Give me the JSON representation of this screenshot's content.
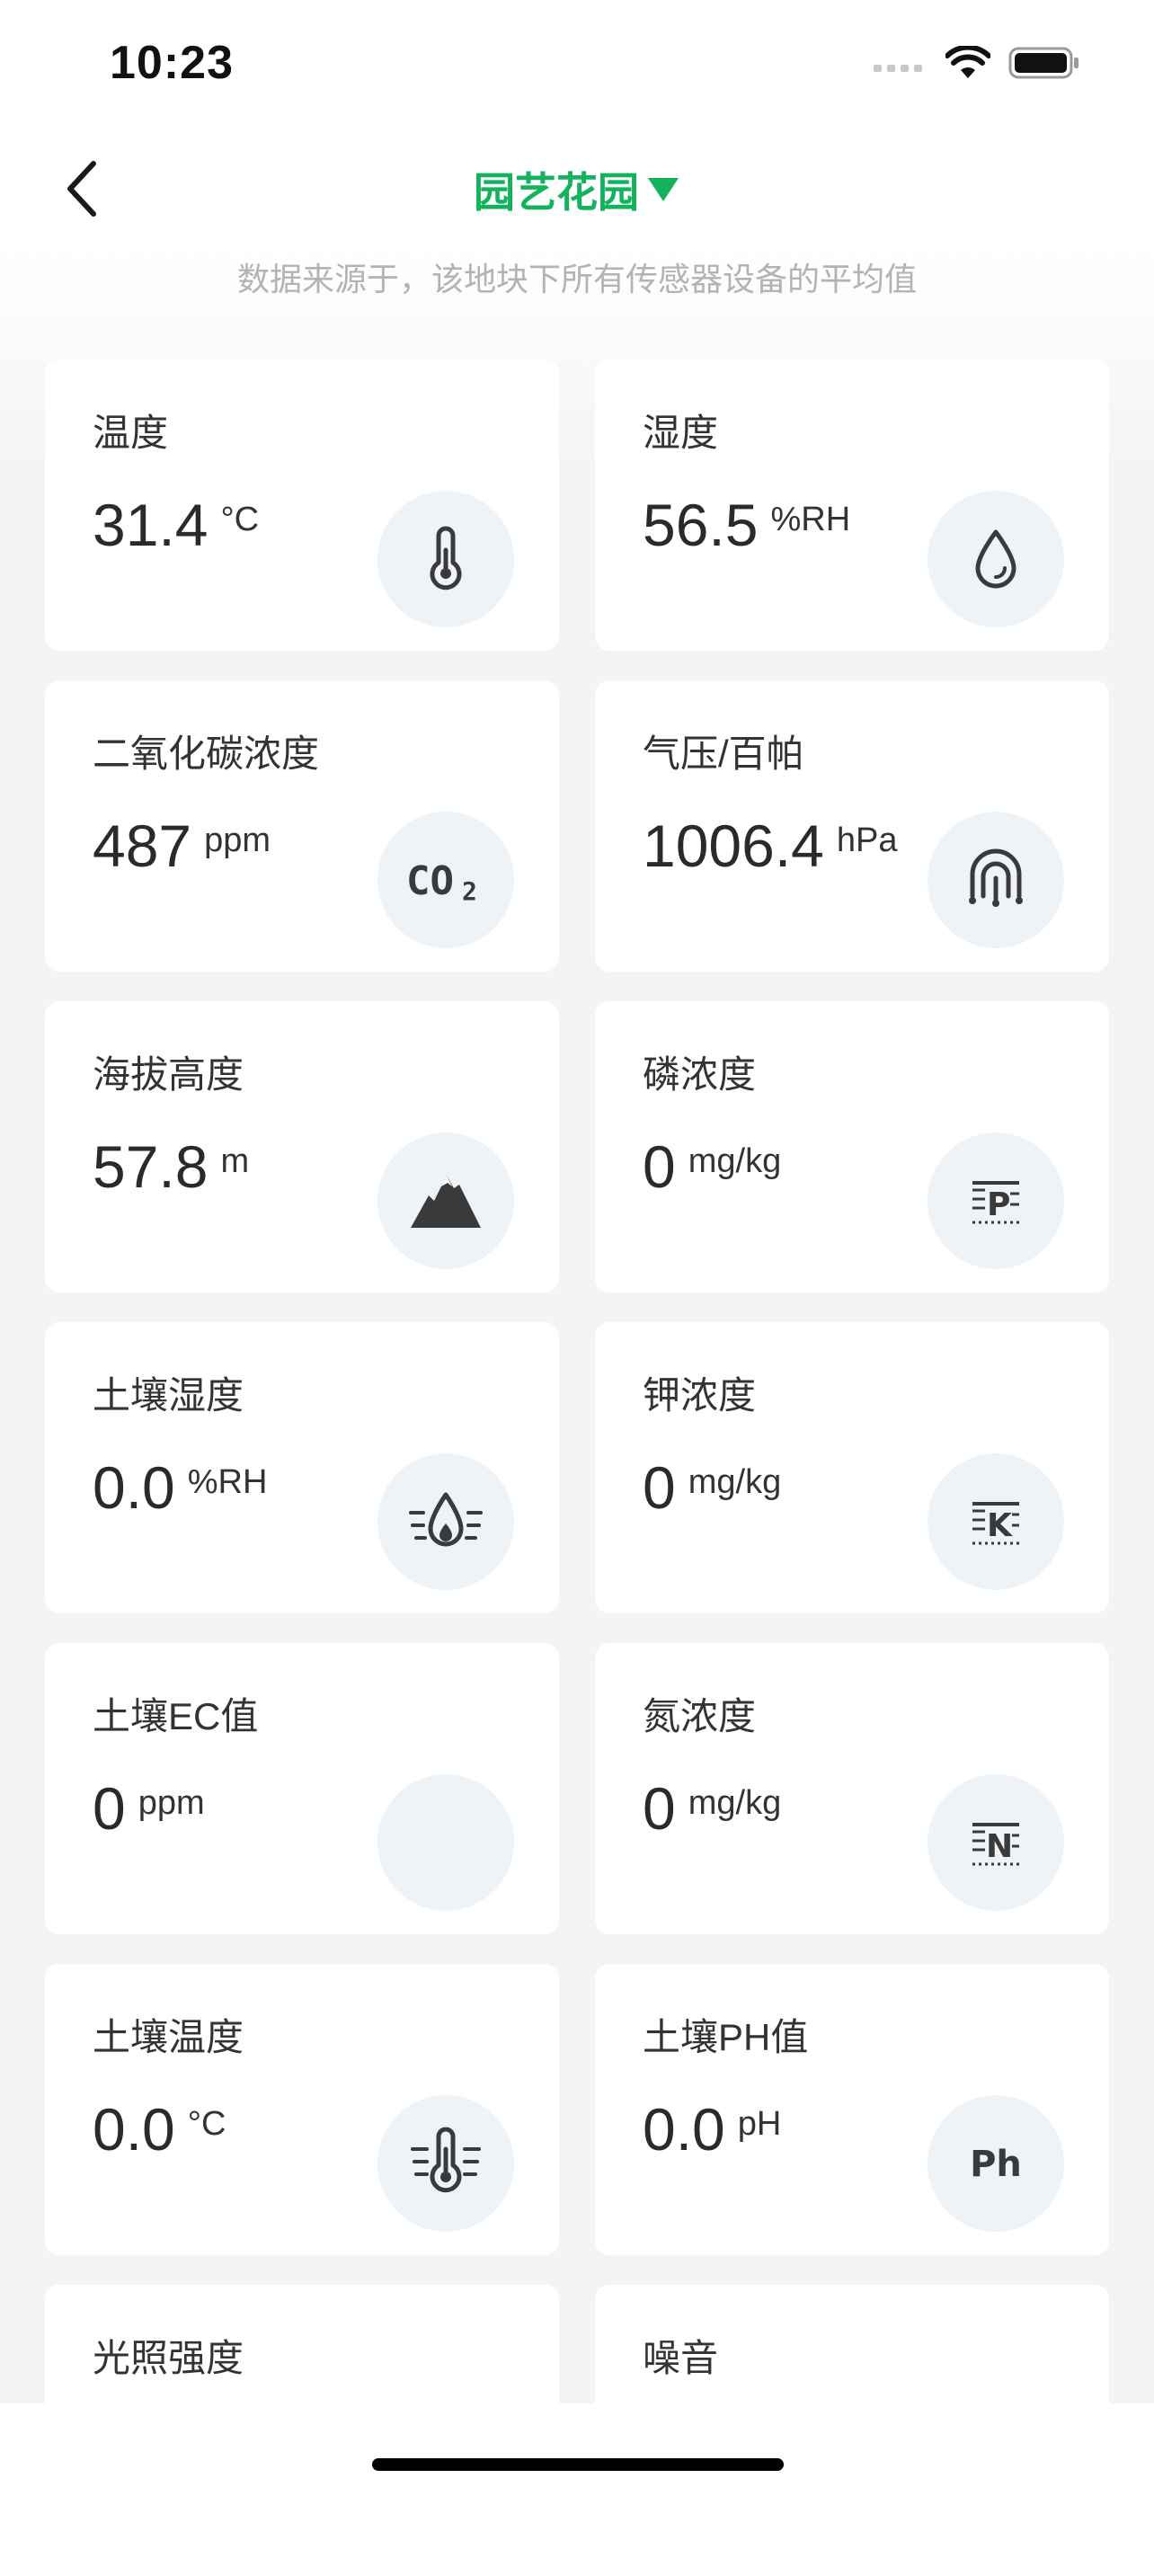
{
  "status_bar": {
    "time": "10:23"
  },
  "nav": {
    "title": "园艺花园",
    "subtitle": "数据来源于，该地块下所有传感器设备的平均值"
  },
  "colors": {
    "accent": "#12b35c",
    "icon_bg": "#eef3f8",
    "page_bg": "#f4f4f5"
  },
  "cards": [
    {
      "label": "温度",
      "value": "31.4",
      "unit": "°C",
      "icon": "thermometer-icon"
    },
    {
      "label": "湿度",
      "value": "56.5",
      "unit": "%RH",
      "icon": "water-drop-icon"
    },
    {
      "label": "二氧化碳浓度",
      "value": "487",
      "unit": "ppm",
      "icon": "co2-icon"
    },
    {
      "label": "气压/百帕",
      "value": "1006.4",
      "unit": "hPa",
      "icon": "pressure-icon"
    },
    {
      "label": "海拔高度",
      "value": "57.8",
      "unit": "m",
      "icon": "mountain-icon"
    },
    {
      "label": "磷浓度",
      "value": "0",
      "unit": "mg/kg",
      "icon": "phosphorus-icon"
    },
    {
      "label": "土壤湿度",
      "value": "0.0",
      "unit": "%RH",
      "icon": "soil-moisture-icon"
    },
    {
      "label": "钾浓度",
      "value": "0",
      "unit": "mg/kg",
      "icon": "potassium-icon"
    },
    {
      "label": "土壤EC值",
      "value": "0",
      "unit": "ppm",
      "icon": "ec-icon"
    },
    {
      "label": "氮浓度",
      "value": "0",
      "unit": "mg/kg",
      "icon": "nitrogen-icon"
    },
    {
      "label": "土壤温度",
      "value": "0.0",
      "unit": "°C",
      "icon": "soil-temperature-icon"
    },
    {
      "label": "土壤PH值",
      "value": "0.0",
      "unit": "pH",
      "icon": "ph-icon"
    },
    {
      "label": "光照强度",
      "value": "",
      "unit": "",
      "icon": ""
    },
    {
      "label": "噪音",
      "value": "",
      "unit": "",
      "icon": ""
    }
  ]
}
